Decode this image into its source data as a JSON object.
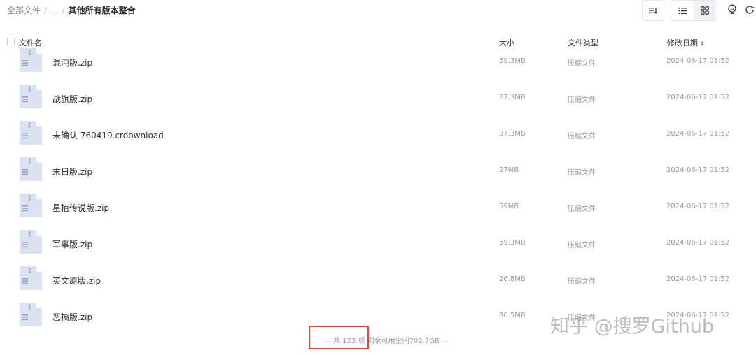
{
  "breadcrumb": {
    "root": "全部文件",
    "sep1": "/",
    "ellipsis": "...",
    "sep2": "/",
    "current": "其他所有版本整合"
  },
  "toolbar": {
    "sort_icon": "sort-lines-icon",
    "list_view_icon": "list-view-icon",
    "grid_view_icon": "grid-view-icon",
    "tip_icon": "lightbulb-icon",
    "refresh_icon": "refresh-icon"
  },
  "columns": {
    "name": "文件名",
    "size": "大小",
    "type": "文件类型",
    "date": "修改日期",
    "date_sort": "⬍"
  },
  "files": [
    {
      "name": "混沌版.zip",
      "size": "59.3MB",
      "type": "压缩文件",
      "date": "2024-06-17 01:52"
    },
    {
      "name": "战旗版.zip",
      "size": "27.3MB",
      "type": "压缩文件",
      "date": "2024-06-17 01:52"
    },
    {
      "name": "未确认 760419.crdownload",
      "size": "37.3MB",
      "type": "压缩文件",
      "date": "2024-06-17 01:52"
    },
    {
      "name": "末日版.zip",
      "size": "27MB",
      "type": "压缩文件",
      "date": "2024-06-17 01:52"
    },
    {
      "name": "星植传说版.zip",
      "size": "59MB",
      "type": "压缩文件",
      "date": "2024-06-17 01:52"
    },
    {
      "name": "军事版.zip",
      "size": "59.3MB",
      "type": "压缩文件",
      "date": "2024-06-17 01:52"
    },
    {
      "name": "英文原版.zip",
      "size": "26.8MB",
      "type": "压缩文件",
      "date": "2024-06-17 01:52"
    },
    {
      "name": "恶搞版.zip",
      "size": "30.5MB",
      "type": "压缩文件",
      "date": "2024-06-17 01:52"
    }
  ],
  "footer": {
    "dash_left": "—",
    "count_text": "共 123 项",
    "space_text": "剩余可用空间702.7GB",
    "dash_right": "—"
  },
  "watermark": "知乎 @搜罗Github",
  "colors": {
    "highlight": "#e0473c",
    "file_icon": "#dbe3f3",
    "file_icon_fold": "#ffffff",
    "zip_mark": "#9aa7c4"
  }
}
